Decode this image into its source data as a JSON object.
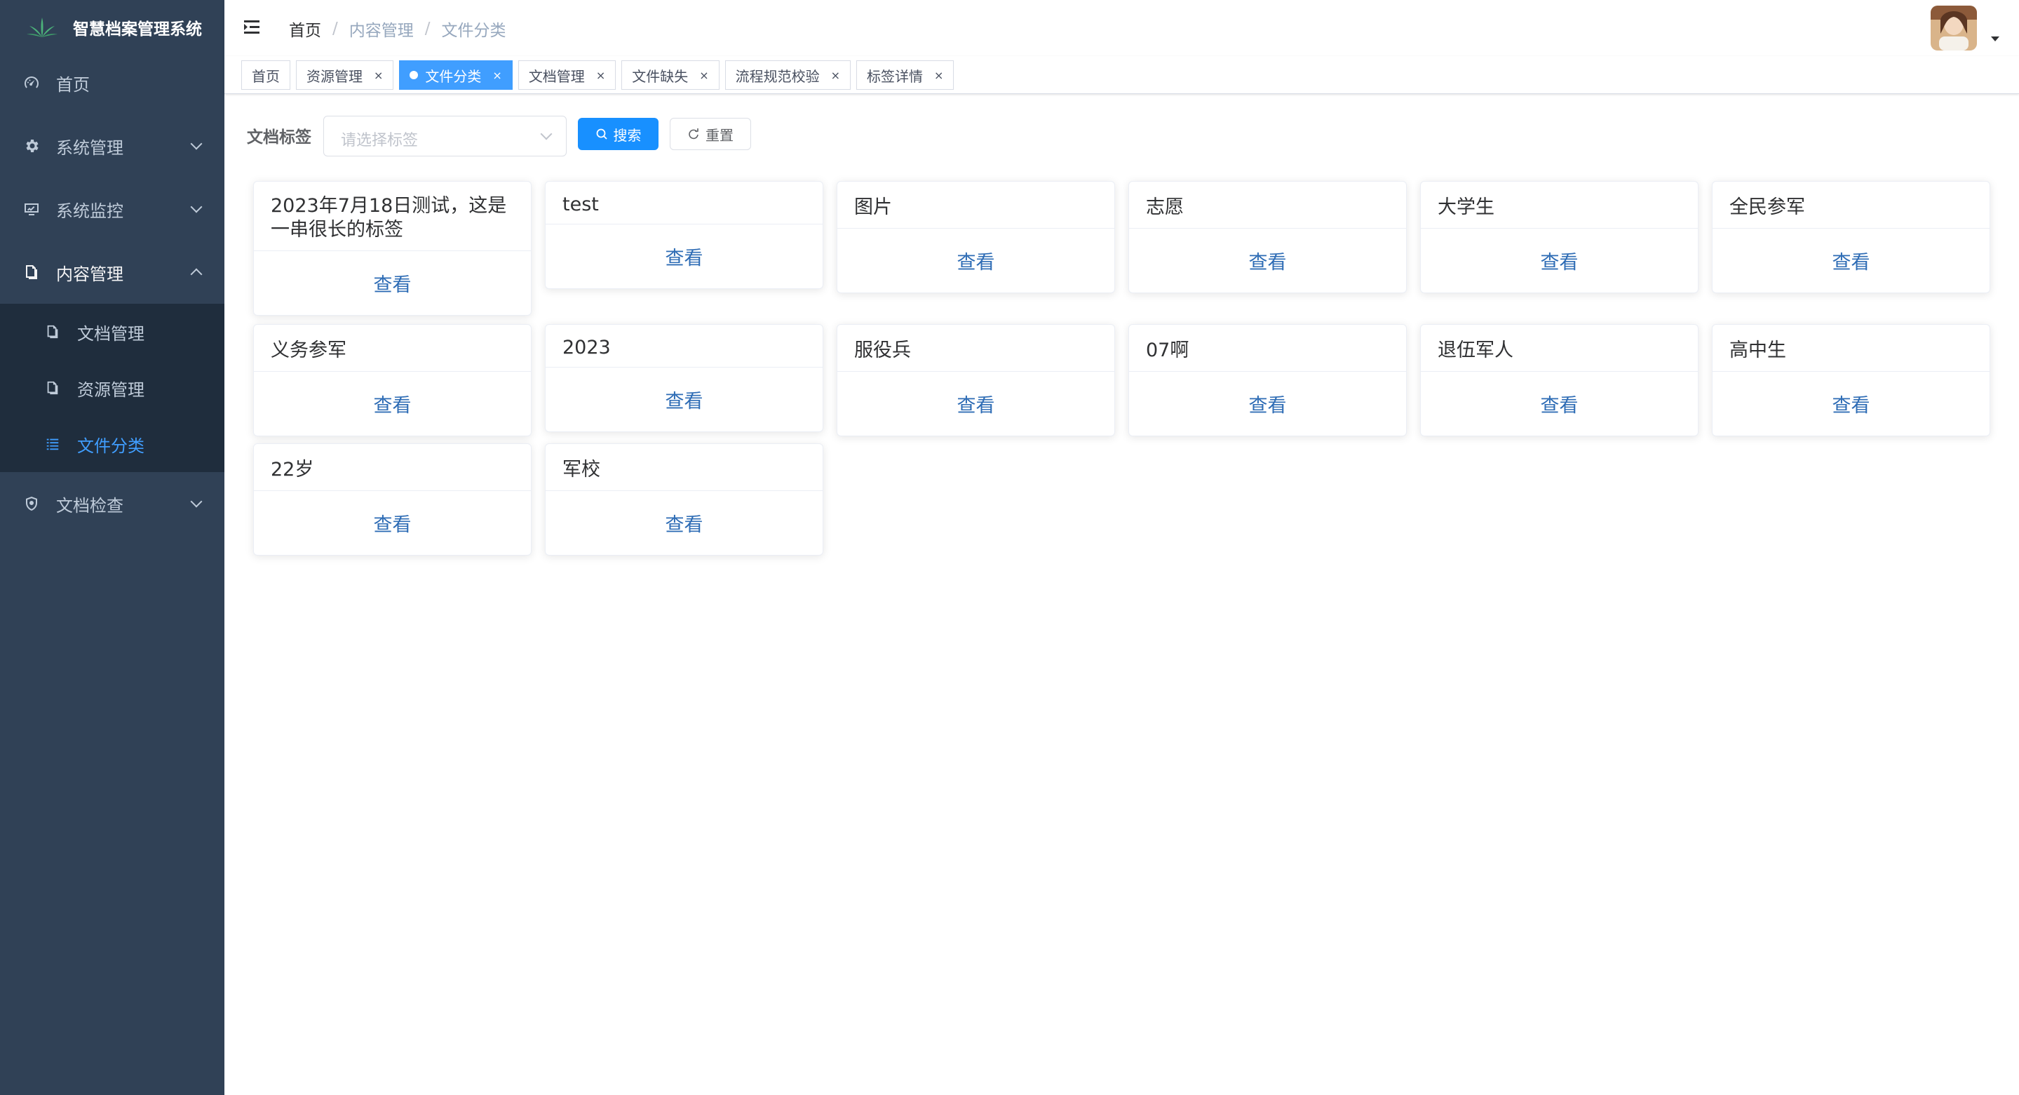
{
  "app": {
    "title": "智慧档案管理系统"
  },
  "sidebar": {
    "items": [
      {
        "label": "首页",
        "icon": "dashboard-icon"
      },
      {
        "label": "系统管理",
        "icon": "gear-icon"
      },
      {
        "label": "系统监控",
        "icon": "monitor-icon"
      },
      {
        "label": "内容管理",
        "icon": "documents-icon"
      },
      {
        "label": "文档检查",
        "icon": "shield-icon"
      }
    ],
    "subitems": [
      {
        "label": "文档管理",
        "icon": "documents-icon"
      },
      {
        "label": "资源管理",
        "icon": "documents-icon"
      },
      {
        "label": "文件分类",
        "icon": "list-icon"
      }
    ]
  },
  "breadcrumb": [
    "首页",
    "内容管理",
    "文件分类"
  ],
  "tags": [
    {
      "label": "首页"
    },
    {
      "label": "资源管理"
    },
    {
      "label": "文件分类"
    },
    {
      "label": "文档管理"
    },
    {
      "label": "文件缺失"
    },
    {
      "label": "流程规范校验"
    },
    {
      "label": "标签详情"
    }
  ],
  "search": {
    "label": "文档标签",
    "placeholder": "请选择标签",
    "search_button": "搜索",
    "reset_button": "重置"
  },
  "cards": [
    {
      "title": "2023年7月18日测试，这是一串很长的标签",
      "action": "查看"
    },
    {
      "title": "test",
      "action": "查看"
    },
    {
      "title": "图片",
      "action": "查看"
    },
    {
      "title": "志愿",
      "action": "查看"
    },
    {
      "title": "大学生",
      "action": "查看"
    },
    {
      "title": "全民参军",
      "action": "查看"
    },
    {
      "title": "义务参军",
      "action": "查看"
    },
    {
      "title": "2023",
      "action": "查看"
    },
    {
      "title": "服役兵",
      "action": "查看"
    },
    {
      "title": "07啊",
      "action": "查看"
    },
    {
      "title": "退伍军人",
      "action": "查看"
    },
    {
      "title": "高中生",
      "action": "查看"
    },
    {
      "title": "22岁",
      "action": "查看"
    },
    {
      "title": "军校",
      "action": "查看"
    }
  ],
  "colors": {
    "sidebar_bg": "#304156",
    "submenu_bg": "#1f2d3d",
    "accent": "#409eff",
    "primary_button": "#1890ff"
  }
}
